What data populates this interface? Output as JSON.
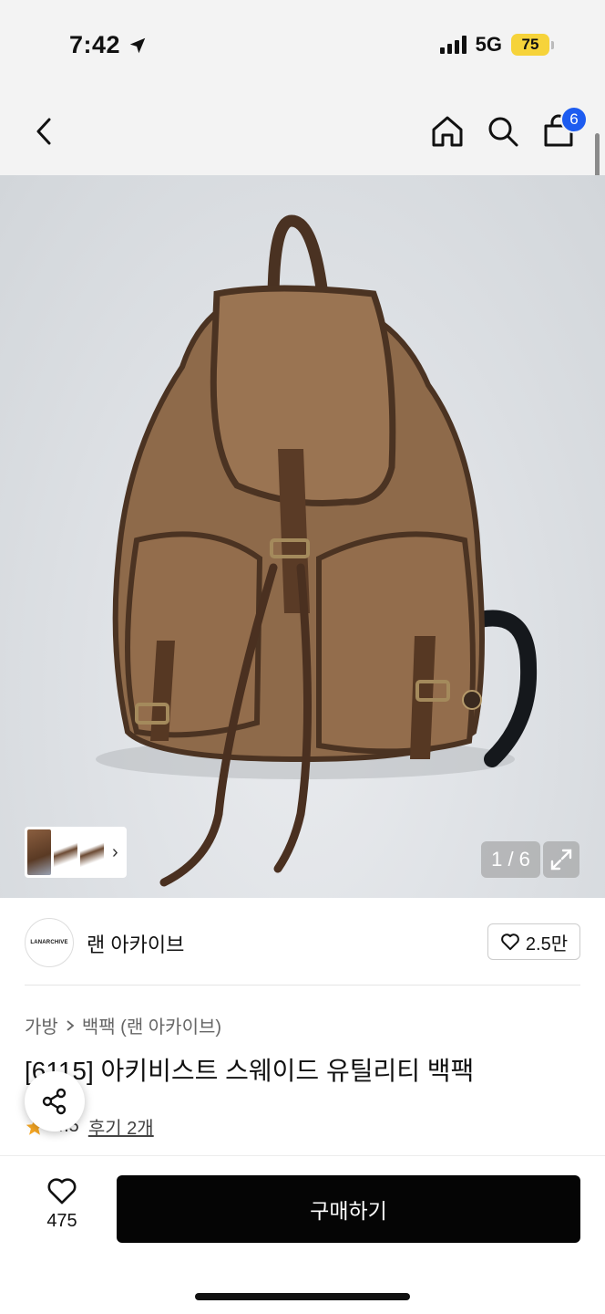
{
  "status_bar": {
    "time": "7:42",
    "network": "5G",
    "battery": "75"
  },
  "nav": {
    "cart_count": "6"
  },
  "gallery": {
    "counter": "1 / 6"
  },
  "brand": {
    "logo_text": "LANARCHIVE",
    "name": "랜 아카이브",
    "likes": "2.5만"
  },
  "breadcrumb": {
    "category": "가방",
    "subcategory": "백팩 (랜 아카이브)"
  },
  "product": {
    "title": "[6115] 아키비스트 스웨이드 유틸리티 백팩",
    "rating": "4.5",
    "reviews": "후기 2개"
  },
  "bottom": {
    "wish_count": "475",
    "buy_label": "구매하기"
  },
  "colors": {
    "cart_badge": "#1d5cf0",
    "battery": "#f6d33a",
    "buy_button": "#050505",
    "star": "#f5a623"
  }
}
